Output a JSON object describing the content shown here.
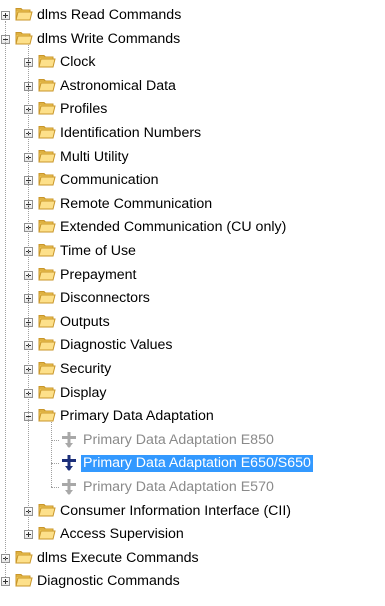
{
  "tree": {
    "nodes": [
      {
        "label": "dlms Read Commands",
        "level": 0,
        "expander": "plus",
        "icon": "folder-icon",
        "state": "normal"
      },
      {
        "label": "dlms Write Commands",
        "level": 0,
        "expander": "minus",
        "icon": "folder-icon",
        "state": "normal"
      },
      {
        "label": "Clock",
        "level": 1,
        "expander": "plus",
        "icon": "folder-icon",
        "state": "normal"
      },
      {
        "label": "Astronomical Data",
        "level": 1,
        "expander": "plus",
        "icon": "folder-icon",
        "state": "normal"
      },
      {
        "label": "Profiles",
        "level": 1,
        "expander": "plus",
        "icon": "folder-icon",
        "state": "normal"
      },
      {
        "label": "Identification Numbers",
        "level": 1,
        "expander": "plus",
        "icon": "folder-icon",
        "state": "normal"
      },
      {
        "label": "Multi Utility",
        "level": 1,
        "expander": "plus",
        "icon": "folder-icon",
        "state": "normal"
      },
      {
        "label": "Communication",
        "level": 1,
        "expander": "plus",
        "icon": "folder-icon",
        "state": "normal"
      },
      {
        "label": "Remote Communication",
        "level": 1,
        "expander": "plus",
        "icon": "folder-icon",
        "state": "normal"
      },
      {
        "label": "Extended Communication (CU only)",
        "level": 1,
        "expander": "plus",
        "icon": "folder-icon",
        "state": "normal"
      },
      {
        "label": "Time of Use",
        "level": 1,
        "expander": "plus",
        "icon": "folder-icon",
        "state": "normal"
      },
      {
        "label": "Prepayment",
        "level": 1,
        "expander": "plus",
        "icon": "folder-icon",
        "state": "normal"
      },
      {
        "label": "Disconnectors",
        "level": 1,
        "expander": "plus",
        "icon": "folder-icon",
        "state": "normal"
      },
      {
        "label": "Outputs",
        "level": 1,
        "expander": "plus",
        "icon": "folder-icon",
        "state": "normal"
      },
      {
        "label": "Diagnostic Values",
        "level": 1,
        "expander": "plus",
        "icon": "folder-icon",
        "state": "normal"
      },
      {
        "label": "Security",
        "level": 1,
        "expander": "plus",
        "icon": "folder-icon",
        "state": "normal"
      },
      {
        "label": "Display",
        "level": 1,
        "expander": "plus",
        "icon": "folder-icon",
        "state": "normal"
      },
      {
        "label": "Primary Data Adaptation",
        "level": 1,
        "expander": "minus",
        "icon": "folder-icon",
        "state": "normal"
      },
      {
        "label": "Primary Data Adaptation E850",
        "level": 2,
        "expander": "none",
        "icon": "write-command-icon",
        "state": "disabled"
      },
      {
        "label": "Primary Data Adaptation E650/S650",
        "level": 2,
        "expander": "none",
        "icon": "write-command-icon",
        "state": "selected"
      },
      {
        "label": "Primary Data Adaptation E570",
        "level": 2,
        "expander": "none",
        "icon": "write-command-icon",
        "state": "disabled"
      },
      {
        "label": "Consumer Information Interface (CII)",
        "level": 1,
        "expander": "plus",
        "icon": "folder-icon",
        "state": "normal"
      },
      {
        "label": "Access Supervision",
        "level": 1,
        "expander": "plus",
        "icon": "folder-icon",
        "state": "normal"
      },
      {
        "label": "dlms Execute Commands",
        "level": 0,
        "expander": "plus",
        "icon": "folder-icon",
        "state": "normal"
      },
      {
        "label": "Diagnostic Commands",
        "level": 0,
        "expander": "plus",
        "icon": "folder-icon",
        "state": "normal"
      }
    ],
    "colors": {
      "selection": "#3399ff",
      "disabled_text": "#8a8a8a",
      "folder_fill": "#f3cc5a",
      "folder_edge": "#c9962a"
    }
  }
}
